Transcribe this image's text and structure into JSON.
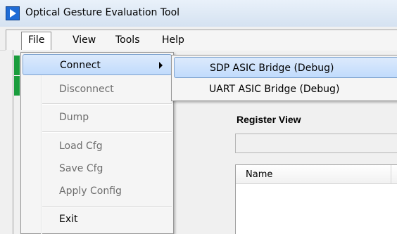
{
  "window": {
    "title": "Optical Gesture Evaluation Tool",
    "icon": "app-logo-icon"
  },
  "menubar": {
    "items": [
      {
        "label": "File"
      },
      {
        "label": "View"
      },
      {
        "label": "Tools"
      },
      {
        "label": "Help"
      }
    ]
  },
  "file_menu": {
    "items": [
      {
        "label": "Connect"
      },
      {
        "label": "Disconnect"
      },
      {
        "label": "Dump"
      },
      {
        "label": "Load Cfg"
      },
      {
        "label": "Save Cfg"
      },
      {
        "label": "Apply Config"
      },
      {
        "label": "Exit"
      }
    ]
  },
  "connect_submenu": {
    "items": [
      {
        "label": "SDP ASIC Bridge (Debug)"
      },
      {
        "label": "UART ASIC Bridge (Debug)"
      }
    ]
  },
  "register_view": {
    "title": "Register View",
    "columns": [
      {
        "label": "Name"
      }
    ]
  }
}
